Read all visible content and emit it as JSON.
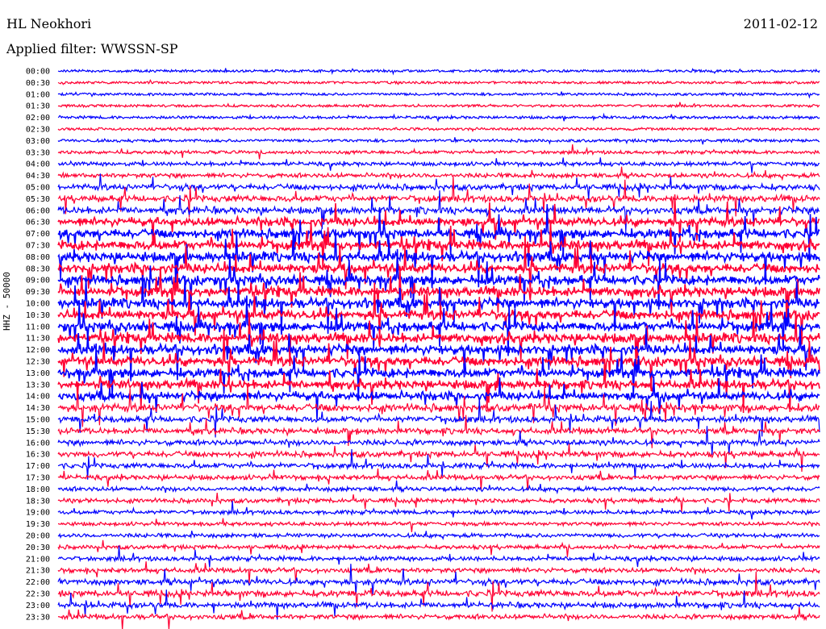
{
  "header": {
    "station": "HL Neokhori",
    "date": "2011-02-12",
    "filter_label": "Applied filter: WWSSN-SP"
  },
  "chart_data": {
    "type": "line",
    "subtype": "helicorder",
    "ylabel": "HHZ - 50000",
    "rows": [
      "00:00",
      "00:30",
      "01:00",
      "01:30",
      "02:00",
      "02:30",
      "03:00",
      "03:30",
      "04:00",
      "04:30",
      "05:00",
      "05:30",
      "06:00",
      "06:30",
      "07:00",
      "07:30",
      "08:00",
      "08:30",
      "09:00",
      "09:30",
      "10:00",
      "10:30",
      "11:00",
      "11:30",
      "12:00",
      "12:30",
      "13:00",
      "13:30",
      "14:00",
      "14:30",
      "15:00",
      "15:30",
      "16:00",
      "16:30",
      "17:00",
      "17:30",
      "18:00",
      "18:30",
      "19:00",
      "19:30",
      "20:00",
      "20:30",
      "21:00",
      "21:30",
      "22:00",
      "22:30",
      "23:00",
      "23:30"
    ],
    "trace_colors": [
      "#0000ff",
      "#ff0033"
    ],
    "activity_level": [
      0.08,
      0.06,
      0.1,
      0.08,
      0.12,
      0.1,
      0.14,
      0.2,
      0.28,
      0.36,
      0.55,
      0.62,
      0.7,
      0.85,
      0.95,
      1.0,
      1.0,
      1.0,
      1.0,
      1.0,
      1.0,
      1.0,
      1.0,
      1.0,
      1.0,
      1.0,
      0.95,
      0.9,
      0.85,
      0.8,
      0.6,
      0.55,
      0.5,
      0.55,
      0.45,
      0.4,
      0.35,
      0.35,
      0.3,
      0.25,
      0.3,
      0.3,
      0.35,
      0.4,
      0.55,
      0.6,
      0.5,
      0.4
    ],
    "grid": false
  }
}
